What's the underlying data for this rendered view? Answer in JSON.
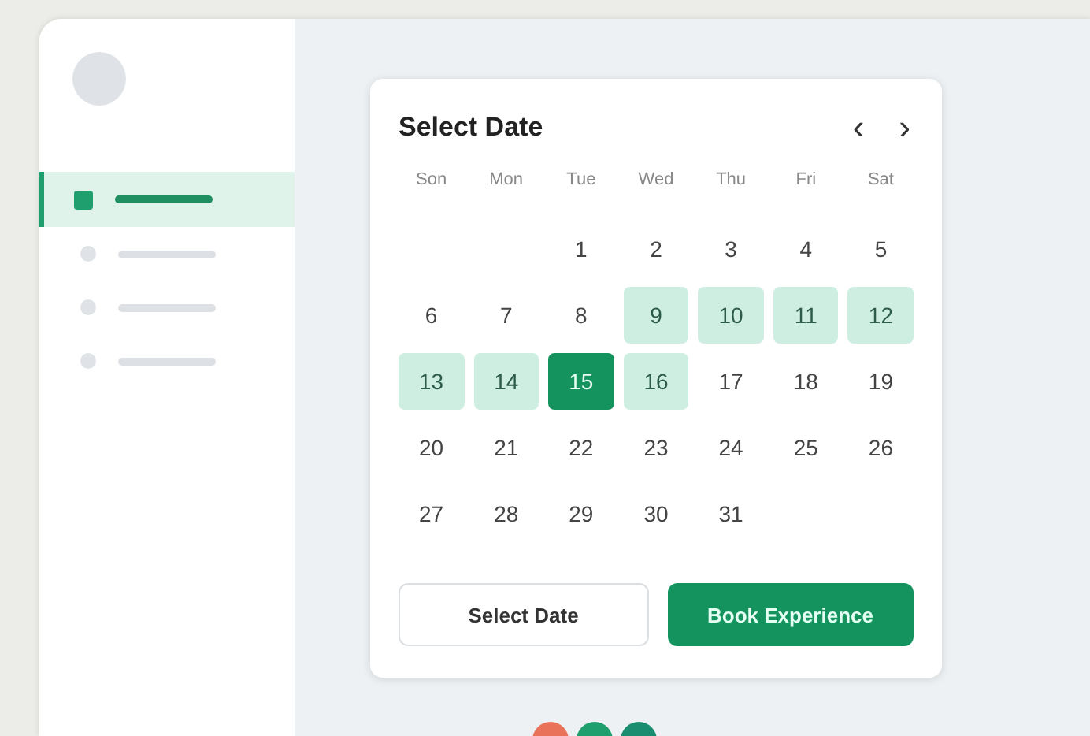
{
  "sidebar": {
    "items": [
      {
        "selected": true
      },
      {
        "selected": false
      },
      {
        "selected": false
      },
      {
        "selected": false
      }
    ]
  },
  "calendar": {
    "title": "Select Date",
    "prev": "‹",
    "next": "›",
    "weekdays": [
      "Son",
      "Mon",
      "Tue",
      "Wed",
      "Thu",
      "Fri",
      "Sat"
    ],
    "weeks": [
      [
        {
          "kind": "blank"
        },
        {
          "kind": "blank"
        },
        {
          "kind": "day",
          "label": "1",
          "selected": false,
          "in_range": false
        },
        {
          "kind": "day",
          "label": "2",
          "selected": false,
          "in_range": false
        },
        {
          "kind": "day",
          "label": "3",
          "selected": false,
          "in_range": false
        },
        {
          "kind": "day",
          "label": "4",
          "selected": false,
          "in_range": false
        },
        {
          "kind": "day",
          "label": "5",
          "selected": false,
          "in_range": false
        }
      ],
      [
        {
          "kind": "day",
          "label": "6",
          "selected": false,
          "in_range": false
        },
        {
          "kind": "day",
          "label": "7",
          "selected": false,
          "in_range": false
        },
        {
          "kind": "day",
          "label": "8",
          "selected": false,
          "in_range": false
        },
        {
          "kind": "day",
          "label": "9",
          "selected": false,
          "in_range": true
        },
        {
          "kind": "day",
          "label": "10",
          "selected": false,
          "in_range": true
        },
        {
          "kind": "day",
          "label": "11",
          "selected": false,
          "in_range": true
        },
        {
          "kind": "day",
          "label": "12",
          "selected": false,
          "in_range": true
        }
      ],
      [
        {
          "kind": "day",
          "label": "13",
          "selected": false,
          "in_range": true
        },
        {
          "kind": "day",
          "label": "14",
          "selected": false,
          "in_range": true
        },
        {
          "kind": "day",
          "label": "15",
          "selected": true
        },
        {
          "kind": "day",
          "label": "16",
          "selected": false,
          "in_range": true
        },
        {
          "kind": "day",
          "label": "17",
          "selected": false,
          "in_range": false
        },
        {
          "kind": "day",
          "label": "18",
          "selected": false,
          "in_range": false
        },
        {
          "kind": "day",
          "label": "19",
          "selected": false,
          "in_range": false
        }
      ],
      [
        {
          "kind": "day",
          "label": "20",
          "selected": false,
          "in_range": false
        },
        {
          "kind": "day",
          "label": "21",
          "selected": false,
          "in_range": false
        },
        {
          "kind": "day",
          "label": "22",
          "selected": false,
          "in_range": false
        },
        {
          "kind": "day",
          "label": "23",
          "selected": false,
          "in_range": false
        },
        {
          "kind": "day",
          "label": "24",
          "selected": false,
          "in_range": false
        },
        {
          "kind": "day",
          "label": "25",
          "selected": false,
          "in_range": false
        },
        {
          "kind": "day",
          "label": "26",
          "selected": false,
          "in_range": false
        }
      ],
      [
        {
          "kind": "day",
          "label": "27",
          "selected": false,
          "in_range": false
        },
        {
          "kind": "day",
          "label": "28",
          "selected": false,
          "in_range": false
        },
        {
          "kind": "day",
          "label": "29",
          "selected": false,
          "in_range": false
        },
        {
          "kind": "day",
          "label": "30",
          "selected": false,
          "in_range": false
        },
        {
          "kind": "day",
          "label": "31",
          "selected": false,
          "in_range": false
        },
        {
          "kind": "blank"
        },
        {
          "kind": "blank"
        }
      ]
    ],
    "buttons": [
      {
        "label": "Select Date",
        "kind": "secondary"
      },
      {
        "label": "Book Experience",
        "kind": "primary"
      }
    ]
  },
  "dots": [
    {
      "color": "#e9735a"
    },
    {
      "color": "#1f9e6e"
    },
    {
      "color": "#1a8d70"
    }
  ]
}
